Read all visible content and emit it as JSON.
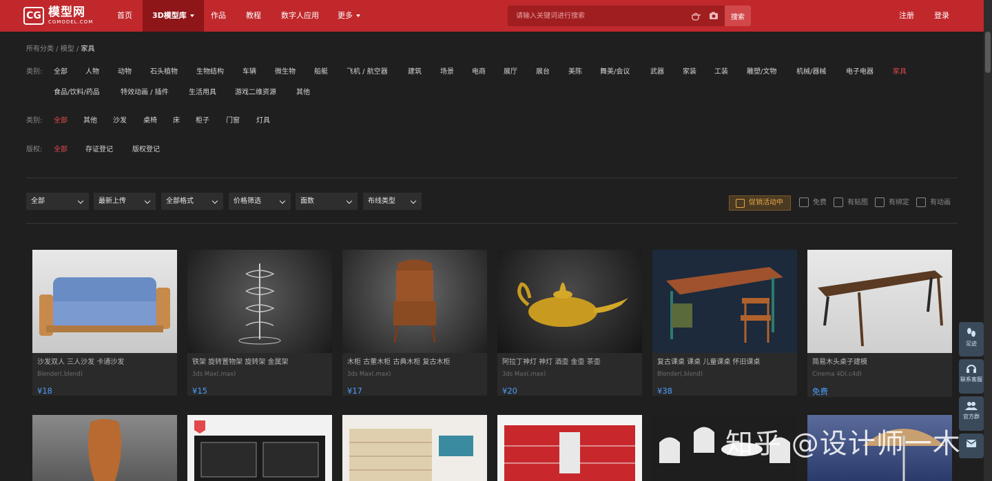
{
  "brand": {
    "logo_mark": "CG",
    "name": "模型网",
    "sub": "CGMODEL.COM"
  },
  "nav": {
    "items": [
      {
        "label": "首页"
      },
      {
        "label": "3D模型库"
      },
      {
        "label": "作品"
      },
      {
        "label": "教程"
      },
      {
        "label": "数字人应用"
      },
      {
        "label": "更多"
      }
    ],
    "register": "注册",
    "login": "登录"
  },
  "search": {
    "placeholder": "请输入关键词进行搜索",
    "button": "搜索"
  },
  "breadcrumb": {
    "root": "所有分类",
    "mid": "模型",
    "current": "家具"
  },
  "filters": {
    "category_label": "类别:",
    "categories_row1": [
      "全部",
      "人物",
      "动物",
      "石头植物",
      "生物结构",
      "车辆",
      "微生物",
      "船艇",
      "飞机 / 航空器",
      "建筑",
      "场景",
      "电商",
      "展厅",
      "展台",
      "美陈",
      "舞美/会议",
      "武器",
      "家装",
      "工装",
      "雕塑/文物",
      "机械/器械",
      "电子电器",
      "家具"
    ],
    "categories_row2": [
      "食品/饮料/药品",
      "特效动画 / 插件",
      "生活用具",
      "游戏二维资源",
      "其他"
    ],
    "subcat_label": "类别:",
    "subcats": [
      "全部",
      "其他",
      "沙发",
      "桌椅",
      "床",
      "柜子",
      "门窗",
      "灯具"
    ],
    "copyright_label": "版权:",
    "copyrights": [
      "全部",
      "存证登记",
      "版权登记"
    ]
  },
  "toolbar": {
    "dropdowns": [
      "全部",
      "最新上传",
      "全部格式",
      "价格筛选",
      "面数",
      "布线类型"
    ],
    "promo": "促销活动中",
    "checks": [
      "免费",
      "有贴图",
      "有绑定",
      "有动画"
    ]
  },
  "cards_row1": [
    {
      "title": "沙发双人 三人沙发 卡通沙发",
      "format": "Blender(.blend)",
      "price": "¥18"
    },
    {
      "title": "铁架 旋转置物架 旋转架 金属架",
      "format": "3ds Max(.max)",
      "price": "¥15"
    },
    {
      "title": "木柜 古董木柜 古典木柜 复古木柜",
      "format": "3ds Max(.max)",
      "price": "¥17"
    },
    {
      "title": "阿拉丁神灯 神灯 酒壶 金壶 茶壶",
      "format": "3ds Max(.max)",
      "price": "¥20"
    },
    {
      "title": "复古课桌 课桌 儿童课桌 怀旧课桌",
      "format": "Blender(.blend)",
      "price": "¥38"
    },
    {
      "title": "简易木头桌子建模",
      "format": "Cinema 4D(.c4d)",
      "price": "免费"
    }
  ],
  "float_bar": [
    "足迹",
    "联系客服",
    "官方群"
  ],
  "watermark": "知乎 @设计师一木",
  "colors": {
    "nav_red": "#c0282c",
    "price_blue": "#4a9eff",
    "selected_red": "#e2484c"
  }
}
